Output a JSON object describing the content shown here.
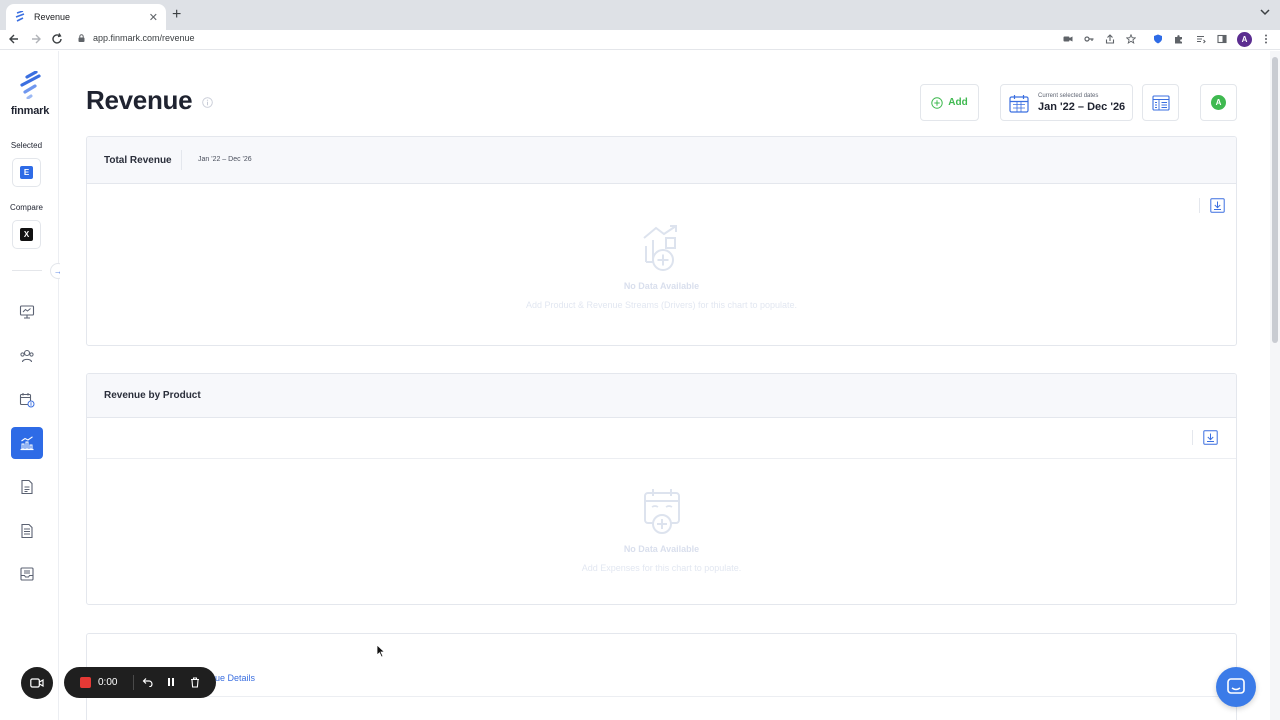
{
  "browser": {
    "tab_title": "Revenue",
    "tab_close": "✕",
    "new_tab": "+",
    "url": "app.finmark.com/revenue",
    "profile_initial": "A"
  },
  "sidebar": {
    "logo_text": "finmark",
    "selected_label": "Selected",
    "selected_scenario": "E",
    "compare_label": "Compare",
    "compare_scenario": "X",
    "expand_arrow": "→",
    "nav_items": [
      {
        "icon": "dashboard-monitor-icon",
        "active": false
      },
      {
        "icon": "people-team-icon",
        "active": false
      },
      {
        "icon": "calendar-dollar-icon",
        "active": false
      },
      {
        "icon": "revenue-chart-icon",
        "active": true
      },
      {
        "icon": "document-dollar-icon",
        "active": false
      },
      {
        "icon": "report-list-icon",
        "active": false
      },
      {
        "icon": "inbox-tray-icon",
        "active": false
      }
    ]
  },
  "header": {
    "title": "Revenue",
    "add_label": "Add",
    "dates_caption": "Current selected dates",
    "dates_value": "Jan '22 – Dec '26",
    "profile_initial": "A"
  },
  "cards": {
    "total_revenue": {
      "title": "Total Revenue",
      "range": "Jan '22 – Dec '26",
      "empty_title": "No Data Available",
      "empty_sub": "Add Product & Revenue Streams (Drivers) for this chart to populate."
    },
    "revenue_by_product": {
      "title": "Revenue by Product",
      "empty_title": "No Data Available",
      "empty_sub": "Add Expenses for this chart to populate."
    },
    "details_link": "nue Details"
  },
  "recorder": {
    "time": "0:00"
  },
  "colors": {
    "accent": "#2e6be6",
    "success": "#3fb950",
    "record": "#e53935"
  }
}
